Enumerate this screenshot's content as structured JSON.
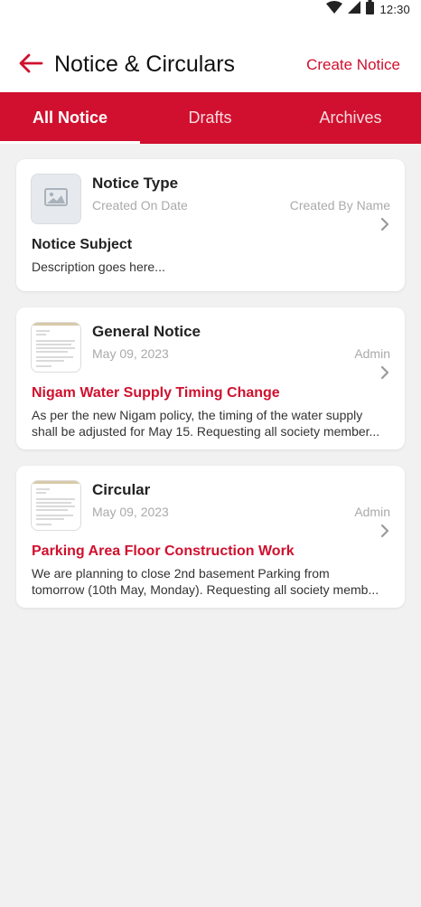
{
  "status_bar": {
    "time": "12:30",
    "icons": [
      "wifi-icon",
      "cellular-signal-icon",
      "battery-icon"
    ]
  },
  "header": {
    "title": "Notice & Circulars",
    "back_icon": "back-arrow-icon",
    "create_label": "Create Notice"
  },
  "tabs": [
    {
      "label": "All Notice",
      "active": true
    },
    {
      "label": "Drafts",
      "active": false
    },
    {
      "label": "Archives",
      "active": false
    }
  ],
  "notices": [
    {
      "type": "Notice Type",
      "date": "Created On Date",
      "author": "Created By Name",
      "subject": "Notice Subject",
      "desc_lines": [
        "Description goes here..."
      ],
      "thumbnail": "image-placeholder-icon"
    },
    {
      "type": "General Notice",
      "date": "May 09, 2023",
      "author": "Admin",
      "subject": "Nigam Water Supply Timing Change",
      "desc_lines": [
        "As per the new Nigam policy, the timing of the water supply",
        "shall be adjusted for May 15. Requesting all society member..."
      ],
      "thumbnail": "document-thumbnail"
    },
    {
      "type": "Circular",
      "date": "May 09, 2023",
      "author": "Admin",
      "subject": "Parking Area Floor Construction Work",
      "desc_lines": [
        "We are planning to close 2nd basement Parking from",
        "tomorrow (10th May, Monday). Requesting all society memb..."
      ],
      "thumbnail": "document-thumbnail"
    }
  ],
  "colors": {
    "accent": "#d0102e",
    "background": "#f1f1f1",
    "card": "#ffffff",
    "muted_text": "#aaaaaa"
  }
}
